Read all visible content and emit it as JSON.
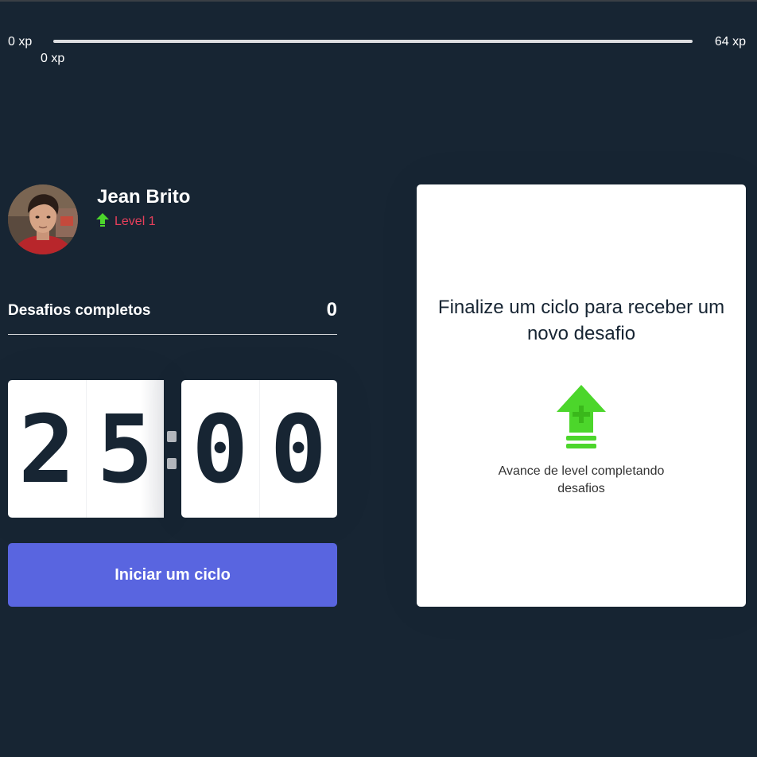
{
  "xp_bar": {
    "start_label": "0 xp",
    "end_label": "64 xp",
    "current_label": "0 xp",
    "progress_percent": 0,
    "accent_color": "#4cd62b"
  },
  "profile": {
    "name": "Jean Brito",
    "level_label": "Level 1",
    "level_icon": "level-up-arrow-icon",
    "level_color": "#e83f5b"
  },
  "completed_challenges": {
    "label": "Desafios completos",
    "count": "0"
  },
  "countdown": {
    "minute_left": "2",
    "minute_right": "5",
    "second_left": "0",
    "second_right": "0"
  },
  "start_button": {
    "label": "Iniciar um ciclo",
    "color": "#5965e0"
  },
  "challenge_box": {
    "title": "Finalize um ciclo para receber um novo desafio",
    "icon": "level-up-icon",
    "description": "Avance de level completando desafios"
  },
  "colors": {
    "background": "#172533",
    "text_dark": "#172533",
    "text_light": "#ffffff"
  }
}
